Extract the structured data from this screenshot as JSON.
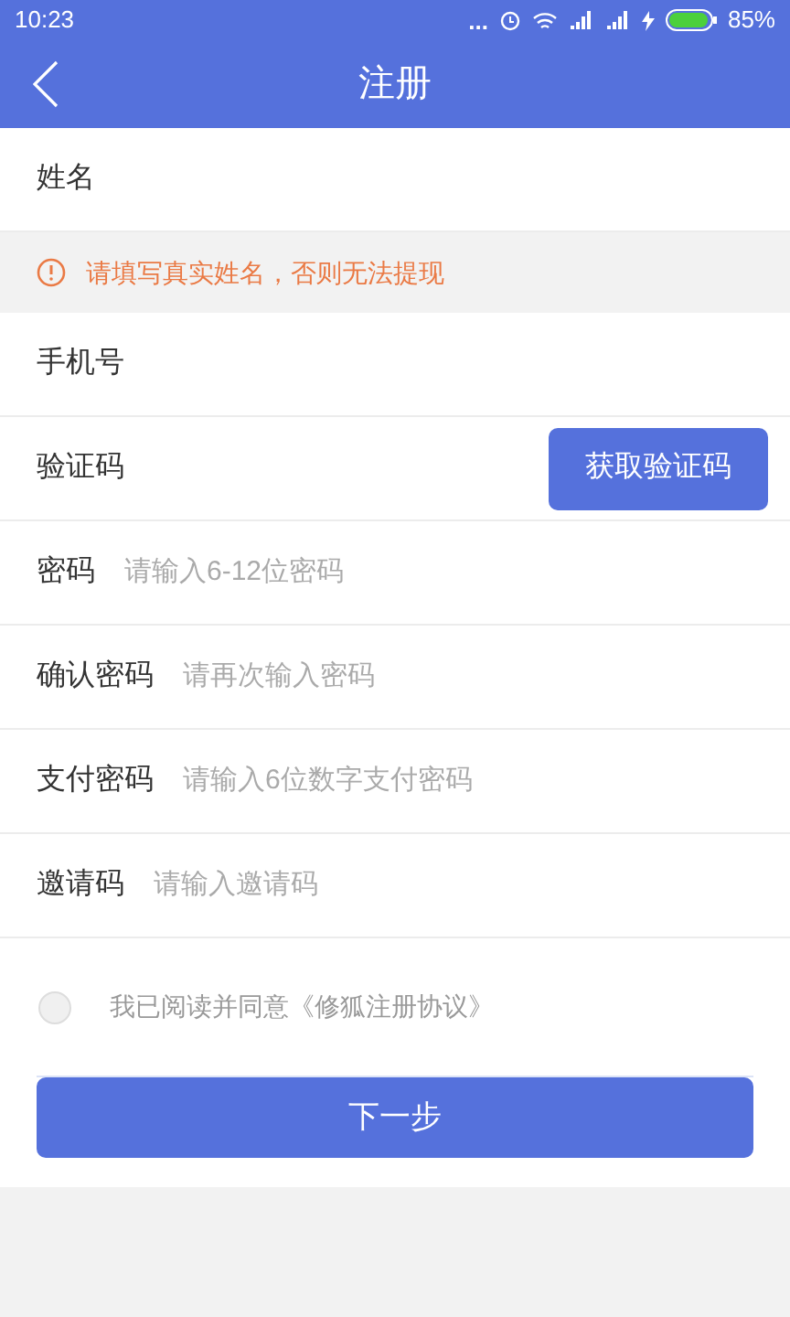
{
  "status_bar": {
    "time": "10:23",
    "dots": "...",
    "battery": "85%"
  },
  "nav": {
    "title": "注册"
  },
  "fields": [
    {
      "label": "姓名"
    },
    {
      "kind": "notice",
      "text": "请填写真实姓名，否则无法提现"
    },
    {
      "label": "手机号"
    },
    {
      "label": "验证码",
      "button": "获取验证码"
    },
    {
      "label": "密码",
      "placeholder": "请输入6-12位密码"
    },
    {
      "label": "确认密码",
      "placeholder": "请再次输入密码"
    },
    {
      "label": "支付密码",
      "placeholder": "请输入6位数字支付密码"
    },
    {
      "label": "邀请码",
      "placeholder": "请输入邀请码"
    }
  ],
  "agreement": {
    "checked": false,
    "text": "我已阅读并同意《修狐注册协议》"
  },
  "submit": "下一步"
}
